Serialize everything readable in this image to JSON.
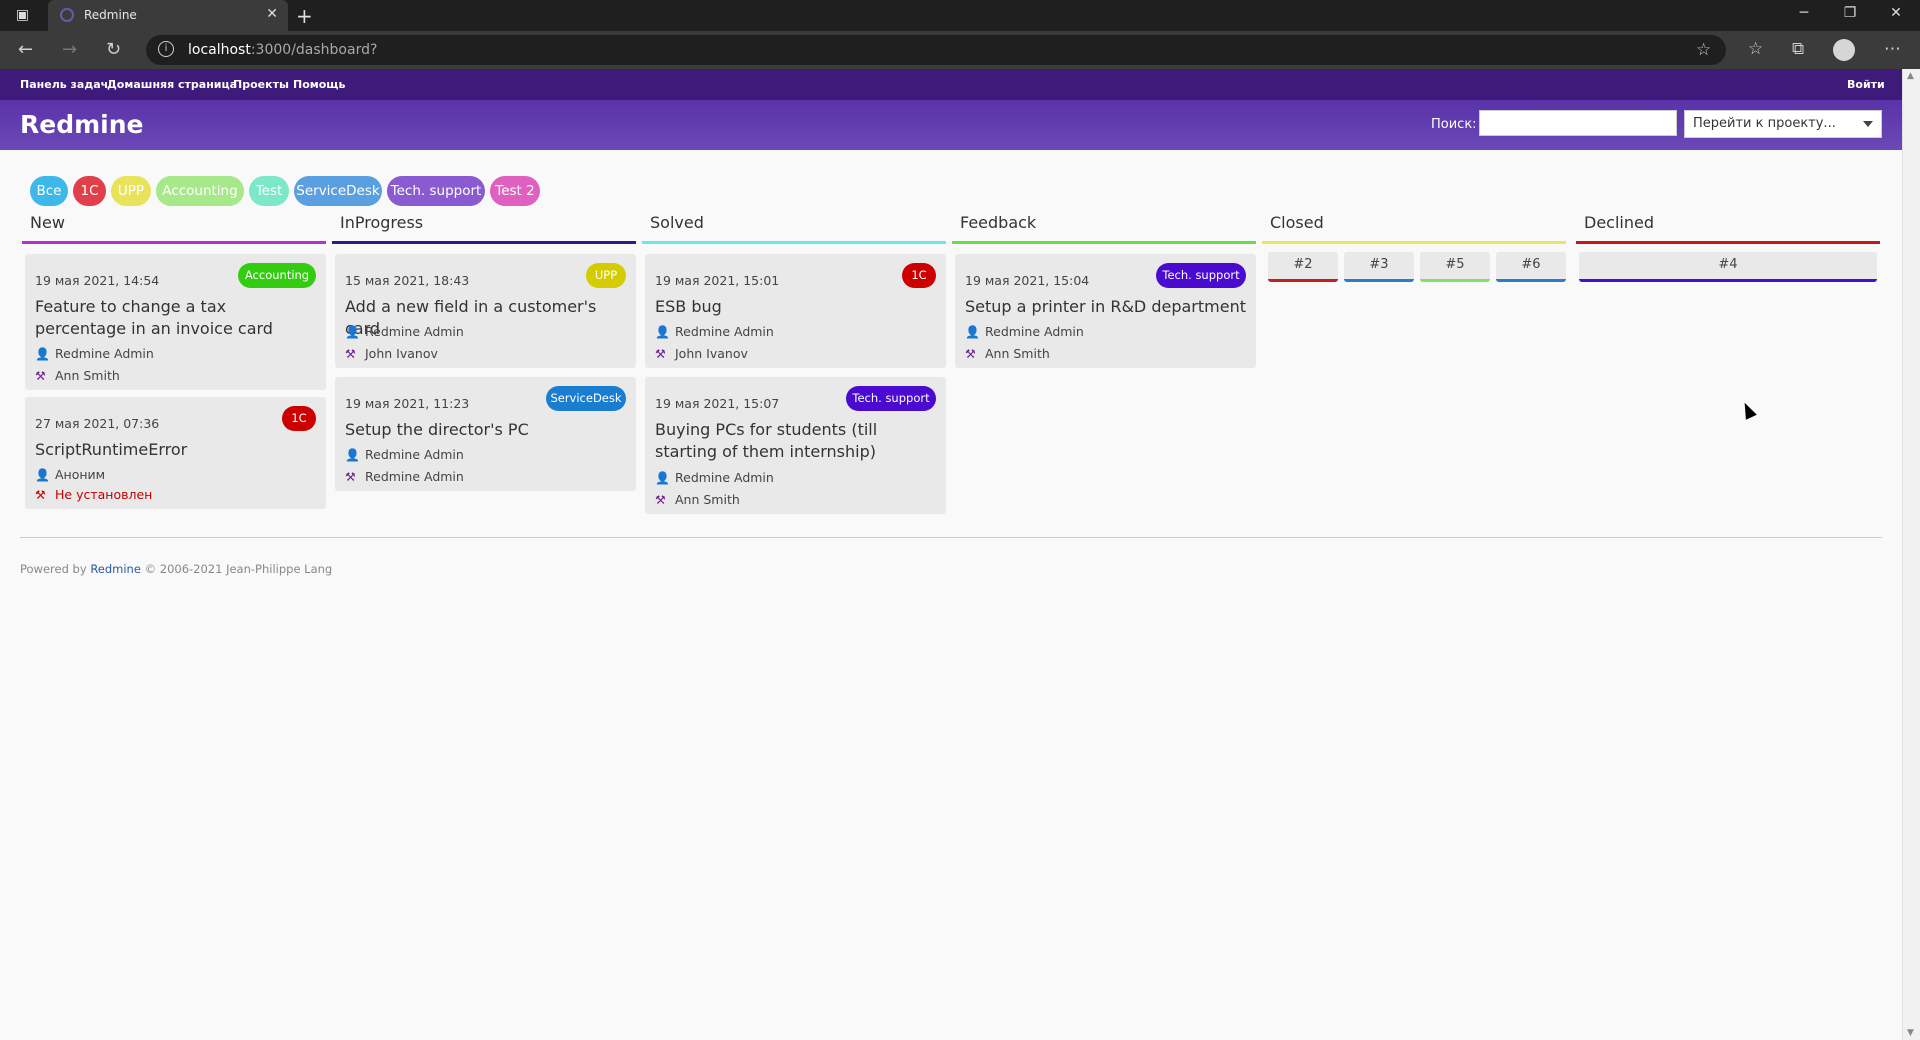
{
  "browser": {
    "tab_title": "Redmine",
    "url_host": "localhost",
    "url_rest": ":3000/dashboard?"
  },
  "topmenu": {
    "items": [
      "Панель задач",
      "Домашняя страница",
      "Проекты",
      "Помощь"
    ],
    "login": "Войти"
  },
  "header": {
    "title": "Redmine",
    "search_label": "Поиск:",
    "search_value": "",
    "project_jump": "Перейти к проекту..."
  },
  "filters": [
    {
      "label": "Все",
      "color": "#3db8e8"
    },
    {
      "label": "1C",
      "color": "#e0404a"
    },
    {
      "label": "UPP",
      "color": "#e8e35a"
    },
    {
      "label": "Accounting",
      "color": "#a6e88a"
    },
    {
      "label": "Test",
      "color": "#7de8c8"
    },
    {
      "label": "ServiceDesk",
      "color": "#5a9fe0"
    },
    {
      "label": "Tech. support",
      "color": "#8a5ad0"
    },
    {
      "label": "Test 2",
      "color": "#e060c0"
    }
  ],
  "columns": [
    {
      "name": "New",
      "color": "#b030d0",
      "cards": [
        {
          "date": "19 мая 2021, 14:54",
          "badge": "Accounting",
          "badge_color": "#33cc11",
          "title": "Feature to change a tax percentage in an invoice card",
          "author": "Redmine Admin",
          "assignee": "Ann Smith"
        },
        {
          "date": "27 мая 2021, 07:36",
          "badge": "1C",
          "badge_color": "#cc0000",
          "title": "ScriptRuntimeError",
          "author": "Аноним",
          "assignee": "Не установлен"
        }
      ]
    },
    {
      "name": "InProgress",
      "color": "#2a1a8a",
      "cards": [
        {
          "date": "15 мая 2021, 18:43",
          "badge": "UPP",
          "badge_color": "#d4cc00",
          "title": "Add a new field in a customer's card",
          "author": "Redmine Admin",
          "assignee": "John Ivanov"
        },
        {
          "date": "19 мая 2021, 11:23",
          "badge": "ServiceDesk",
          "badge_color": "#1a7ed0",
          "title": "Setup the director's PC",
          "author": "Redmine Admin",
          "assignee": "Redmine Admin"
        }
      ]
    },
    {
      "name": "Solved",
      "color": "#6ae8e8",
      "cards": [
        {
          "date": "19 мая 2021, 15:01",
          "badge": "1C",
          "badge_color": "#cc0000",
          "title": "ESB bug",
          "author": "Redmine Admin",
          "assignee": "John Ivanov"
        },
        {
          "date": "19 мая 2021, 15:07",
          "badge": "Tech. support",
          "badge_color": "#4a0ad0",
          "title": "Buying PCs for students (till starting of them internship)",
          "author": "Redmine Admin",
          "assignee": "Ann Smith"
        }
      ]
    },
    {
      "name": "Feedback",
      "color": "#66e040",
      "cards": [
        {
          "date": "19 мая 2021, 15:04",
          "badge": "Tech. support",
          "badge_color": "#4a0ad0",
          "title": "Setup a printer in R&D department",
          "author": "Redmine Admin",
          "assignee": "Ann Smith"
        }
      ]
    },
    {
      "name": "Closed",
      "color": "#e8e860",
      "items": [
        {
          "label": "#2",
          "color": "#c02020"
        },
        {
          "label": "#3",
          "color": "#2a7ad0"
        },
        {
          "label": "#5",
          "color": "#88dd66"
        },
        {
          "label": "#6",
          "color": "#2a7ad0"
        }
      ]
    },
    {
      "name": "Declined",
      "color": "#c01a1a",
      "items": [
        {
          "label": "#4",
          "color": "#4a0ad0"
        }
      ]
    }
  ],
  "footer": {
    "prefix": "Powered by",
    "link": "Redmine",
    "suffix": "© 2006-2021 Jean-Philippe Lang"
  }
}
